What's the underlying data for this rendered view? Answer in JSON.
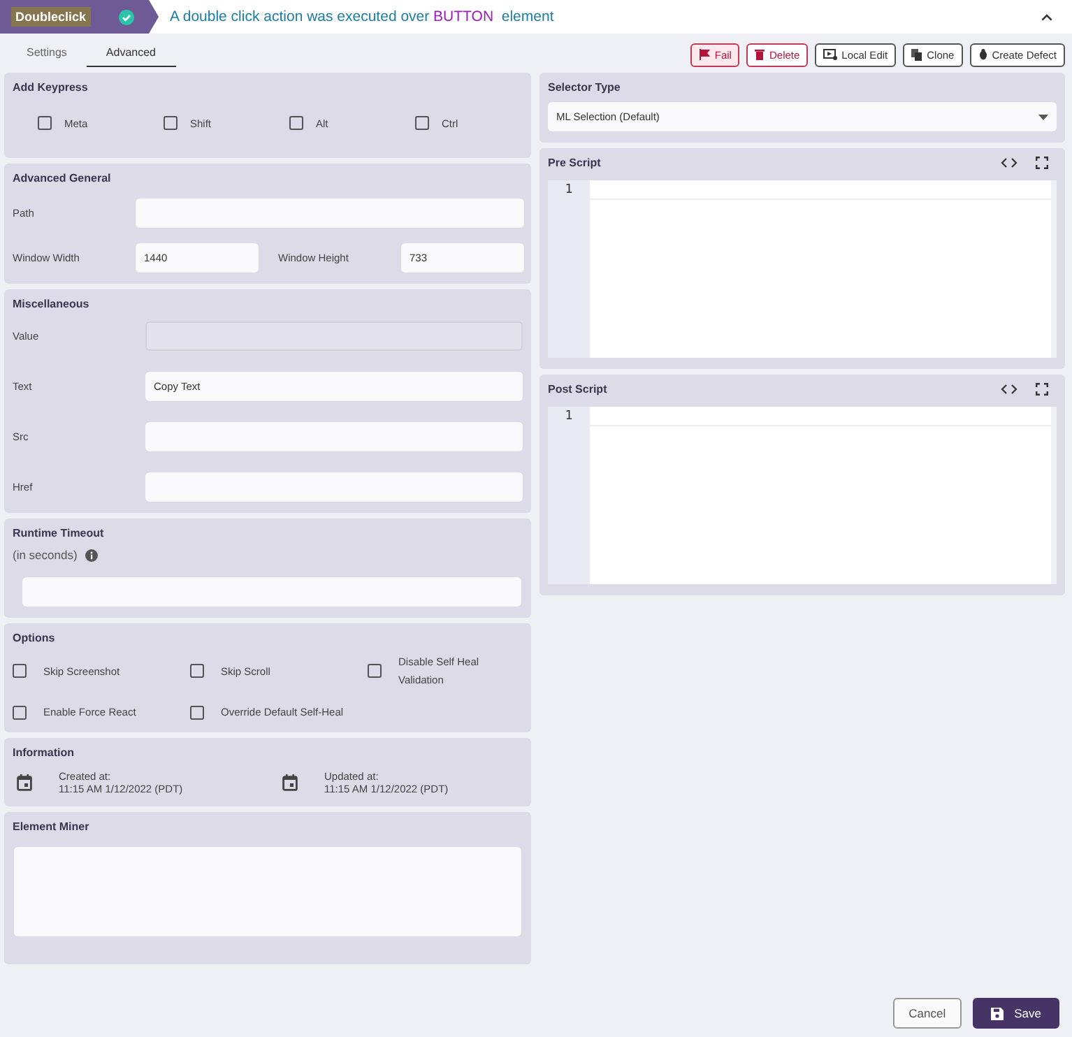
{
  "step": {
    "name": "Doubleclick",
    "passed": true,
    "message": {
      "before": "A double click action was executed over",
      "target": "BUTTON",
      "after": "element"
    }
  },
  "tabs": [
    {
      "label": "Settings",
      "selected": false
    },
    {
      "label": "Advanced",
      "selected": true
    }
  ],
  "actions": [
    {
      "label": "Fail",
      "kind": "fail"
    },
    {
      "label": "Delete",
      "kind": "delete"
    },
    {
      "label": "Local Edit",
      "kind": "edit"
    },
    {
      "label": "Clone",
      "kind": "clone"
    },
    {
      "label": "Create Defect",
      "kind": "defect"
    }
  ],
  "keypress": {
    "title": "Add Keypress",
    "options": [
      {
        "label": "Meta",
        "checked": false
      },
      {
        "label": "Shift",
        "checked": false
      },
      {
        "label": "Alt",
        "checked": false
      },
      {
        "label": "Ctrl",
        "checked": false
      }
    ]
  },
  "advanced_general": {
    "title": "Advanced General",
    "path": {
      "label": "Path"
    },
    "window_width": {
      "label": "Window Width",
      "value": "1440"
    },
    "window_height": {
      "label": "Window Height",
      "value": "733"
    }
  },
  "miscellaneous": {
    "title": "Miscellaneous",
    "fields": [
      {
        "label": "Value",
        "disabled": true
      },
      {
        "label": "Text",
        "value": "Copy Text",
        "disabled": false
      },
      {
        "label": "Src",
        "disabled": false
      },
      {
        "label": "Href",
        "disabled": false
      }
    ]
  },
  "runtime_timeout": {
    "title": "Runtime Timeout",
    "hint": "(in seconds)"
  },
  "options": {
    "title": "Options",
    "items": [
      {
        "label": "Skip Screenshot",
        "checked": false
      },
      {
        "label": "Skip Scroll",
        "checked": false
      },
      {
        "label": "Disable Self Heal Validation",
        "checked": false
      },
      {
        "label": "Enable Force React",
        "checked": false
      },
      {
        "label": "Override Default Self-Heal",
        "checked": false
      }
    ]
  },
  "information": {
    "title": "Information",
    "items": [
      {
        "label": "Created at:",
        "value": "11:15 AM 1/12/2022 (PDT)"
      },
      {
        "label": "Updated at:",
        "value": "11:15 AM 1/12/2022 (PDT)"
      }
    ]
  },
  "element_miner": {
    "title": "Element Miner"
  },
  "selector_type": {
    "title": "Selector Type",
    "value": "ML Selection (Default)"
  },
  "scripts": [
    {
      "title": "Pre Script",
      "lines": [
        "1"
      ]
    },
    {
      "title": "Post Script",
      "lines": [
        "1"
      ]
    }
  ],
  "footer": {
    "cancel": "Cancel",
    "save": "Save"
  }
}
